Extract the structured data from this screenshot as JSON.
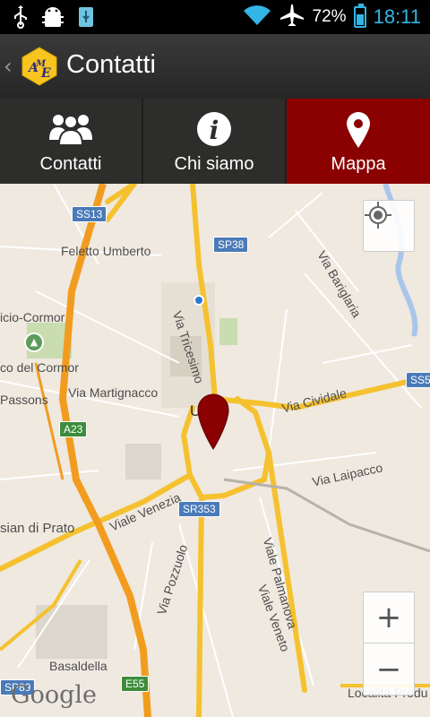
{
  "status_bar": {
    "battery_percent": "72%",
    "time": "18:11",
    "icons": [
      "usb-icon",
      "android-debug-icon",
      "usb-storage-icon",
      "wifi-icon",
      "airplane-icon",
      "battery-charging-icon"
    ],
    "clock_color": "#33b5e5"
  },
  "action_bar": {
    "title": "Contatti",
    "logo_text": "AME"
  },
  "tabs": [
    {
      "label": "Contatti",
      "icon": "group-icon",
      "active": false
    },
    {
      "label": "Chi siamo",
      "icon": "info-icon",
      "active": false
    },
    {
      "label": "Mappa",
      "icon": "map-pin-icon",
      "active": true
    }
  ],
  "colors": {
    "accent_active_tab": "#8b0000",
    "map_background": "#efe9e0",
    "major_road": "#f5c12e",
    "highway": "#f29c1f"
  },
  "map": {
    "labels": {
      "feletto": "Feletto Umberto",
      "cormor_top": "icio-Cormor",
      "cormor_park": "co del Cormor",
      "passons": "Passons",
      "via_martignacco": "Via Martignacco",
      "via_tricesimo": "Via Tricesimo",
      "via_bariglaria": "Via Bariglaria",
      "via_cividale": "Via Cividale",
      "udine": "Udine",
      "via_laipacco": "Via Laipacco",
      "viale_venezia": "Viale Venezia",
      "sian_di_prato": "sian di Prato",
      "via_pozzuolo": "Via Pozzuolo",
      "viale_palmanova": "Viale Palmanova",
      "viale_veneto": "Viale Veneto",
      "basaldella": "Basaldella",
      "localita": "Località Produ"
    },
    "shields": {
      "ss13": "SS13",
      "sp38": "SP38",
      "a23": "A23",
      "sr353": "SR353",
      "e55": "E55",
      "ss5": "SS5",
      "sp89": "SP89"
    },
    "controls": {
      "zoom_in": "+",
      "zoom_out": "−"
    },
    "attribution": "Google"
  }
}
